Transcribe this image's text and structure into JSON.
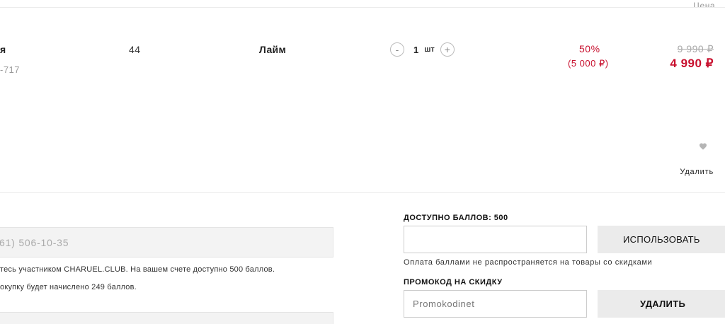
{
  "cart_item": {
    "column_header": "Цена",
    "name_fragment": "я",
    "sku_fragment": "-717",
    "size": "44",
    "color": "Лайм",
    "quantity": {
      "decrease_label": "-",
      "value": "1",
      "unit": "шт",
      "increase_label": "+"
    },
    "discount_percent": "50%",
    "discount_amount": "(5 000 ₽)",
    "old_price": "9 990 ₽",
    "new_price": "4 990 ₽",
    "favorite_icon": "heart-icon",
    "remove_label": "Удалить"
  },
  "loyalty": {
    "phone_value": "61) 506-10-35",
    "member_info": "тесь участником CHARUEL.CLUB. На вашем счете доступно 500 баллов.",
    "accrual_info": "окупку будет начислено 249 баллов."
  },
  "points": {
    "title": "ДОСТУПНО БАЛЛОВ: 500",
    "input_value": "",
    "use_button": "ИСПОЛЬЗОВАТЬ",
    "note": "Оплата баллами не распространяется на товары со скидками"
  },
  "promo": {
    "title": "ПРОМОКОД НА СКИДКУ",
    "placeholder": "Promokodinet",
    "delete_button": "УДАЛИТЬ"
  },
  "colors": {
    "accent_red": "#c8102e",
    "muted_gray": "#aaaaaa",
    "button_bg": "#ebebeb"
  }
}
